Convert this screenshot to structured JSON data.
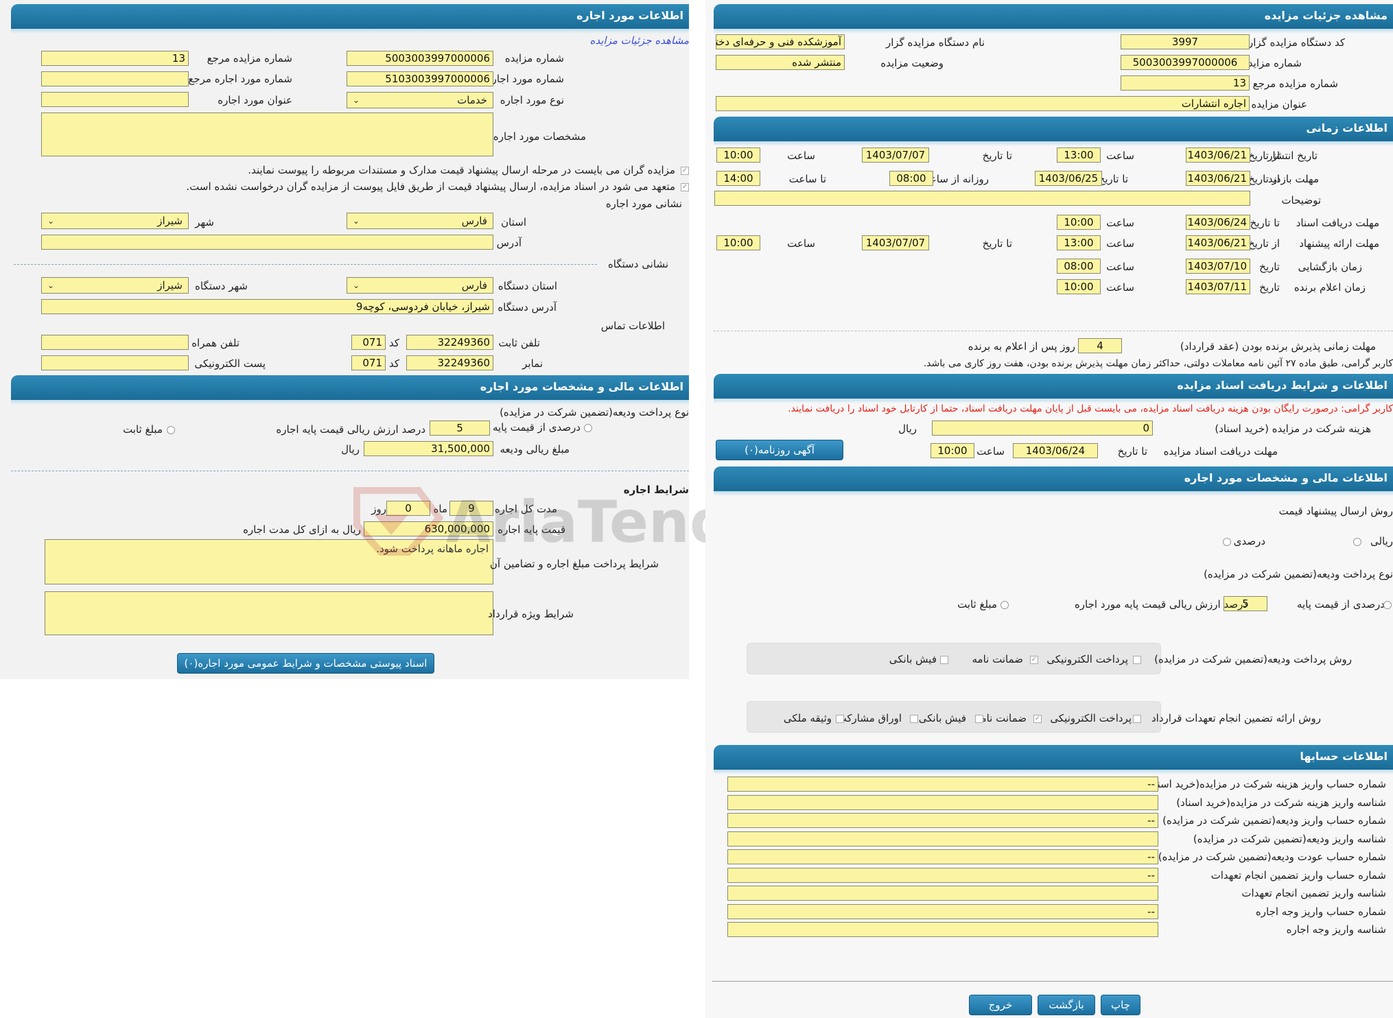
{
  "left": {
    "h1": "اطلاعات مورد اجاره",
    "view_link": "مشاهده جزئیات مزایده",
    "auction_no_lbl": "شماره مزایده",
    "auction_no": "5003003997000006",
    "ref_auction_no_lbl": "شماره مزایده مرجع",
    "ref_auction_no": "13",
    "lease_item_no_lbl": "شماره مورد اجاره",
    "lease_item_no": "5103003997000006",
    "ref_lease_item_lbl": "شماره مورد اجاره مرجع",
    "ref_lease_item": "",
    "lease_type_lbl": "نوع مورد اجاره",
    "lease_type": "خدمات",
    "lease_title_lbl": "عنوان مورد اجاره",
    "lease_title": "",
    "lease_spec_lbl": "مشخصات مورد اجاره",
    "lease_spec": "",
    "note1": "مزایده گران می بایست در مرحله ارسال پیشنهاد قیمت مدارک و مستندات مربوطه را پیوست نمایند.",
    "note2": "متعهد می شود در اسناد مزایده، ارسال پیشنهاد قیمت از طریق فایل پیوست از مزایده گران درخواست نشده است.",
    "lease_addr_title": "نشانی مورد اجاره",
    "province_lbl": "استان",
    "province": "فارس",
    "city_lbl": "شهر",
    "city": "شیراز",
    "address_lbl": "آدرس",
    "address": "",
    "org_addr_title": "نشانی دستگاه",
    "org_province_lbl": "استان دستگاه",
    "org_province": "فارس",
    "org_city_lbl": "شهر دستگاه",
    "org_city": "شیراز",
    "org_address_lbl": "آدرس دستگاه",
    "org_address": "شیراز، خیابان فردوسی، کوچه9",
    "contact_title": "اطلاعات تماس",
    "phone_lbl": "تلفن ثابت",
    "phone": "32249360",
    "code_lbl": "کد",
    "code": "071",
    "mobile_lbl": "تلفن همراه",
    "mobile": "",
    "fax_lbl": "نمابر",
    "fax": "32249360",
    "fax_code": "071",
    "email_lbl": "پست الکترونیکی",
    "email": "",
    "h2": "اطلاعات مالی و مشخصات مورد اجاره",
    "deposit_type_lbl": "نوع پرداخت ودیعه(تضمین شرکت در مزایده)",
    "percent_lbl": "درصدی از قیمت پایه",
    "percent_val": "5",
    "percent_desc": "درصد ارزش ریالی قیمت پایه اجاره",
    "fixed_lbl": "مبلغ ثابت",
    "deposit_amount_lbl": "مبلغ ریالی ودیعه",
    "deposit_amount": "31,500,000",
    "rial": "ریال",
    "terms_title": "شرایط اجاره",
    "duration_lbl": "مدت کل اجاره",
    "months": "9",
    "month_lbl": "ماه",
    "days": "0",
    "day_lbl": "روز",
    "base_price_lbl": "قیمت پایه اجاره",
    "base_price": "630,000,000",
    "base_price_unit": "ریال به ازای کل مدت اجاره",
    "pay_terms_lbl": "شرایط پرداخت مبلغ اجاره و تضامین آن",
    "pay_terms": "اجاره ماهانه پرداخت شود.",
    "special_terms_lbl": "شرایط ویژه قرارداد",
    "special_terms": "",
    "attach_btn": "اسناد پیوستی مشخصات و شرایط عمومی مورد اجاره(۰)",
    "watermark": "AriaTender.neT"
  },
  "right": {
    "h1": "مشاهده جزئیات مزایده",
    "org_code_lbl": "کد دستگاه مزایده گزار",
    "org_code": "3997",
    "org_name_lbl": "نام دستگاه مزایده گزار",
    "org_name": "آموزشکده فنی و حرفه‌ای دختران شیراز",
    "auction_no_lbl": "شماره مزایده",
    "auction_no": "5003003997000006",
    "status_lbl": "وضعیت مزایده",
    "status": "منتشر شده",
    "ref_no_lbl": "شماره مزایده مرجع",
    "ref_no": "13",
    "title_lbl": "عنوان مزایده",
    "title": "اجاره انتشارات",
    "h2": "اطلاعات زمانی",
    "publish_lbl": "تاریخ انتشار",
    "from_date_lbl": "از تاریخ",
    "to_date_lbl": "تا تاریخ",
    "time_lbl": "ساعت",
    "to_time_lbl": "تا ساعت",
    "date_lbl": "تاریخ",
    "publish_from": "1403/06/21",
    "publish_from_time": "13:00",
    "publish_to": "1403/07/07",
    "publish_to_time": "10:00",
    "visit_lbl": "مهلت بازدید",
    "visit_from": "1403/06/21",
    "visit_to": "1403/06/25",
    "daily_from_lbl": "روزانه از ساعت",
    "daily_from": "08:00",
    "daily_to": "14:00",
    "desc_lbl": "توضیحات",
    "desc": "",
    "doc_deadline_lbl": "مهلت دریافت اسناد",
    "doc_to": "1403/06/24",
    "doc_to_time": "10:00",
    "offer_lbl": "مهلت ارائه پیشنهاد",
    "offer_from": "1403/06/21",
    "offer_from_time": "13:00",
    "offer_to": "1403/07/07",
    "offer_to_time": "10:00",
    "opening_lbl": "زمان بازگشایی",
    "opening_date": "1403/07/10",
    "opening_time": "08:00",
    "winner_lbl": "زمان اعلام برنده",
    "winner_date": "1403/07/11",
    "winner_time": "10:00",
    "accept_lbl": "مهلت زمانی پذیرش برنده بودن (عقد قرارداد)",
    "accept_days": "4",
    "accept_suffix": "روز پس از اعلام به برنده",
    "accept_note": "کاربر گرامی، طبق ماده ۲۷ آئین نامه معاملات دولتی، حداکثر زمان مهلت پذیرش برنده بودن، هفت روز کاری می باشد.",
    "h3": "اطلاعات و شرایط دریافت اسناد مزایده",
    "free_note": "کاربر گرامی: درصورت رایگان بودن هزینه دریافت اسناد مزایده، می بایست قبل از پایان مهلت دریافت اسناد، حتما از کارتابل خود اسناد را دریافت نمایند.",
    "fee_lbl": "هزینه شرکت در مزایده (خرید اسناد)",
    "fee": "0",
    "rial": "ریال",
    "doc_recv_lbl": "مهلت دریافت اسناد مزایده",
    "doc_recv_to": "1403/06/24",
    "doc_recv_time": "10:00",
    "newspaper_btn": "آگهی روزنامه(۰)",
    "h4": "اطلاعات مالی و مشخصات مورد اجاره",
    "offer_method_lbl": "روش ارسال پیشنهاد قیمت",
    "rial_opt": "ریالی",
    "percent_opt": "درصدی",
    "deposit_type_lbl": "نوع پرداخت ودیعه(تضمین شرکت در مزایده)",
    "percent_base_lbl": "درصدی از قیمت پایه",
    "percent_val": "5",
    "percent_desc": "درصد ارزش ریالی قیمت پایه مورد اجاره",
    "fixed_lbl": "مبلغ ثابت",
    "deposit_method_lbl": "روش پرداخت ودیعه(تضمین شرکت در مزایده)",
    "epay": "پرداخت الکترونیکی",
    "guarantee": "ضمانت نامه",
    "bank_slip": "فیش بانکی",
    "commit_lbl": "روش ارائه تضمین انجام تعهدات قرارداد",
    "bonds": "اوراق مشارکت",
    "property": "وثیقه ملکی",
    "h5": "اطلاعات حسابها",
    "accounts": [
      {
        "label": "شماره حساب واریز هزینه شرکت در مزایده(خرید اسناد)",
        "value": "--"
      },
      {
        "label": "شناسه واریز هزینه شرکت در مزایده(خرید اسناد)",
        "value": ""
      },
      {
        "label": "شماره حساب واریز ودیعه(تضمین شرکت در مزایده)",
        "value": "--"
      },
      {
        "label": "شناسه واریز ودیعه(تضمین شرکت در مزایده)",
        "value": ""
      },
      {
        "label": "شماره حساب عودت ودیعه(تضمین شرکت در مزایده)",
        "value": "--"
      },
      {
        "label": "شماره حساب واریز تضمین انجام تعهدات",
        "value": "--"
      },
      {
        "label": "شناسه واریز تضمین انجام تعهدات",
        "value": ""
      },
      {
        "label": "شماره حساب واریز وجه اجاره",
        "value": "--"
      },
      {
        "label": "شناسه واریز وجه اجاره",
        "value": ""
      }
    ],
    "print_btn": "چاپ",
    "back_btn": "بازگشت",
    "exit_btn": "خروج"
  }
}
